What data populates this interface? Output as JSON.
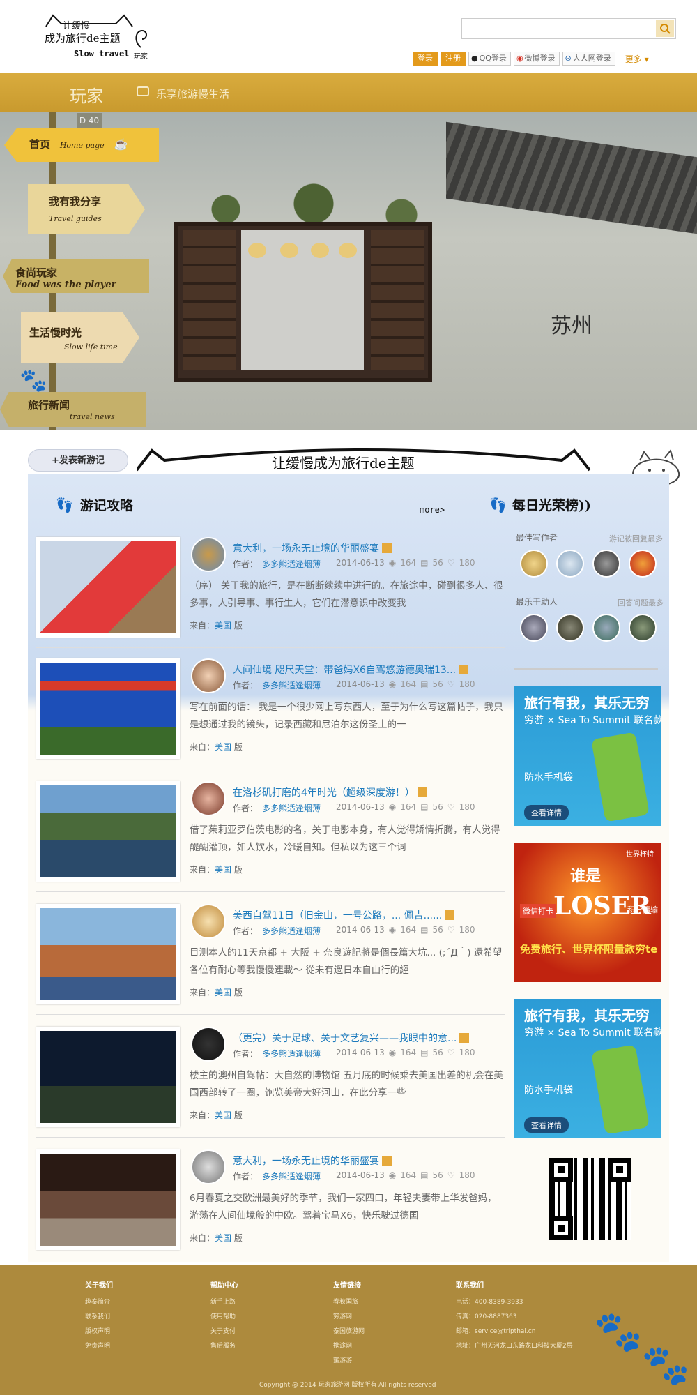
{
  "header": {
    "logo": {
      "line1": "让缓慢",
      "line2": "成为旅行de主题",
      "line3": "Slow travel",
      "line4": "玩家"
    },
    "search": {
      "placeholder": ""
    },
    "login_label": "登录",
    "register_label": "注册",
    "social": [
      {
        "label": "QQ登录",
        "icon": "qq-icon"
      },
      {
        "label": "微博登录",
        "icon": "weibo-icon"
      },
      {
        "label": "人人网登录",
        "icon": "renren-icon"
      }
    ],
    "more_label": "更多"
  },
  "banner": {
    "brand": "玩家",
    "tagline": "乐享旅游慢生活"
  },
  "hero": {
    "nav": [
      {
        "cn": "首页",
        "en": "Home page"
      },
      {
        "cn": "我有我分享",
        "en": "Travel guides"
      },
      {
        "cn": "食尚玩家",
        "en": "Food was the player",
        "prefix": "2.5\n3.5"
      },
      {
        "cn": "生活慢时光",
        "en": "Slow life time"
      },
      {
        "cn": "旅行新闻",
        "en": "travel news"
      }
    ],
    "plaque": "D 40",
    "city": "苏州"
  },
  "slogan": {
    "post_button": "+发表新游记",
    "text": "让缓慢成为旅行de主题"
  },
  "sections": {
    "guides_title": "游记攻略",
    "more_label": "more>",
    "ranking_title": "每日光荣榜))"
  },
  "articles": [
    {
      "title": "意大利，一场永无止境的华丽盛宴",
      "author_label": "作者：",
      "author": "多多熊适逢烟薄",
      "date": "2014-06-13",
      "views": "164",
      "comments": "56",
      "likes": "180",
      "excerpt": "（序） 关于我的旅行，是在断断续续中进行的。在旅途中，碰到很多人、很多事，人引导事、事行生人，它们在潜意识中改变我",
      "from_label": "来自：",
      "country": "美国",
      "version": "版"
    },
    {
      "title": "人间仙境 咫尺天堂：带爸妈X6自驾悠游德奥瑞13...",
      "author_label": "作者：",
      "author": "多多熊适逢烟薄",
      "date": "2014-06-13",
      "views": "164",
      "comments": "56",
      "likes": "180",
      "excerpt": "写在前面的话： 我是一个很少网上写东西人，至于为什么写这篇帖子，我只是想通过我的镜头，记录西藏和尼泊尔这份圣土的一",
      "from_label": "来自：",
      "country": "美国",
      "version": "版"
    },
    {
      "title": "在洛杉矶打磨的4年时光（超级深度游！）",
      "author_label": "作者：",
      "author": "多多熊适逢烟薄",
      "date": "2014-06-13",
      "views": "164",
      "comments": "56",
      "likes": "180",
      "excerpt": "借了茱莉亚罗伯茨电影的名，关于电影本身，有人觉得矫情折腾，有人觉得醍醐灌顶，如人饮水，冷暖自知。但私以为这三个词",
      "from_label": "来自：",
      "country": "美国",
      "version": "版"
    },
    {
      "title": "美西自驾11日（旧金山，一号公路，... 佩吉......",
      "author_label": "作者：",
      "author": "多多熊适逢烟薄",
      "date": "2014-06-13",
      "views": "164",
      "comments": "56",
      "likes": "180",
      "excerpt": "目测本人的11天京都 + 大阪 + 奈良遊記將是個長篇大坑... (;´Д｀) 還希望各位有耐心等我慢慢連載～ 從未有過日本自由行的經",
      "from_label": "来自：",
      "country": "美国",
      "version": "版"
    },
    {
      "title": "（更完）关于足球、关于文艺复兴——我眼中的意...",
      "author_label": "作者：",
      "author": "多多熊适逢烟薄",
      "date": "2014-06-13",
      "views": "164",
      "comments": "56",
      "likes": "180",
      "excerpt": "楼主的澳州自驾帖：大自然的博物馆 五月底的时候乘去美国出差的机会在美国西部转了一圈，饱览美帝大好河山，在此分享一些",
      "from_label": "来自：",
      "country": "美国",
      "version": "版"
    },
    {
      "title": "意大利，一场永无止境的华丽盛宴",
      "author_label": "作者：",
      "author": "多多熊适逢烟薄",
      "date": "2014-06-13",
      "views": "164",
      "comments": "56",
      "likes": "180",
      "excerpt": "6月春夏之交欧洲最美好的季节，我们一家四口，年轻夫妻带上华发爸妈，游荡在人间仙境般的中欧。驾着宝马X6，快乐驶过德国",
      "from_label": "来自：",
      "country": "美国",
      "version": "版"
    }
  ],
  "sidebar": {
    "best_writer": "最佳写作者",
    "best_writer_hint": "游记被回复最多",
    "best_helper": "最乐于助人",
    "best_helper_hint": "回答问题最多"
  },
  "ads": [
    {
      "headline": "旅行有我，其乐无穷",
      "sub": "穷游 × Sea To Summit 联名款",
      "product": "防水手机袋",
      "cta": "查看详情"
    },
    {
      "worldcup": "世界杯特",
      "who": "谁是",
      "loser": "LOSER",
      "left": "微信打卡",
      "right": "积分猜输",
      "bottom": "免费旅行、世界杯限量款穷te 运动手环等你拿！"
    },
    {
      "headline": "旅行有我，其乐无穷",
      "sub": "穷游 × Sea To Summit 联名款",
      "product": "防水手机袋",
      "cta": "查看详情"
    }
  ],
  "footer": {
    "columns": [
      {
        "title": "关于我们",
        "items": [
          "趣泰简介",
          "联系我们",
          "版权声明",
          "免责声明"
        ]
      },
      {
        "title": "帮助中心",
        "items": [
          "新手上路",
          "使用帮助",
          "关于支付",
          "售后服务"
        ]
      },
      {
        "title": "友情链接",
        "items": [
          "春秋国旅",
          "穷游网",
          "泰国旅游网",
          "携途网",
          "蜜游游"
        ]
      },
      {
        "title": "联系我们",
        "items": [
          "电话：400-8389-3933",
          "传真：020-8887363",
          "邮箱：service@tripthai.cn",
          "地址：广州天河龙口东路龙口科技大厦2层"
        ]
      }
    ],
    "copyright": "Copyright @ 2014 玩家旅游网 版权所有  All rights reserved"
  },
  "colors": {
    "gold": "#c99a2e",
    "orange": "#e39a1b",
    "link": "#1e7bbd",
    "footer": "#ad8a3d"
  }
}
